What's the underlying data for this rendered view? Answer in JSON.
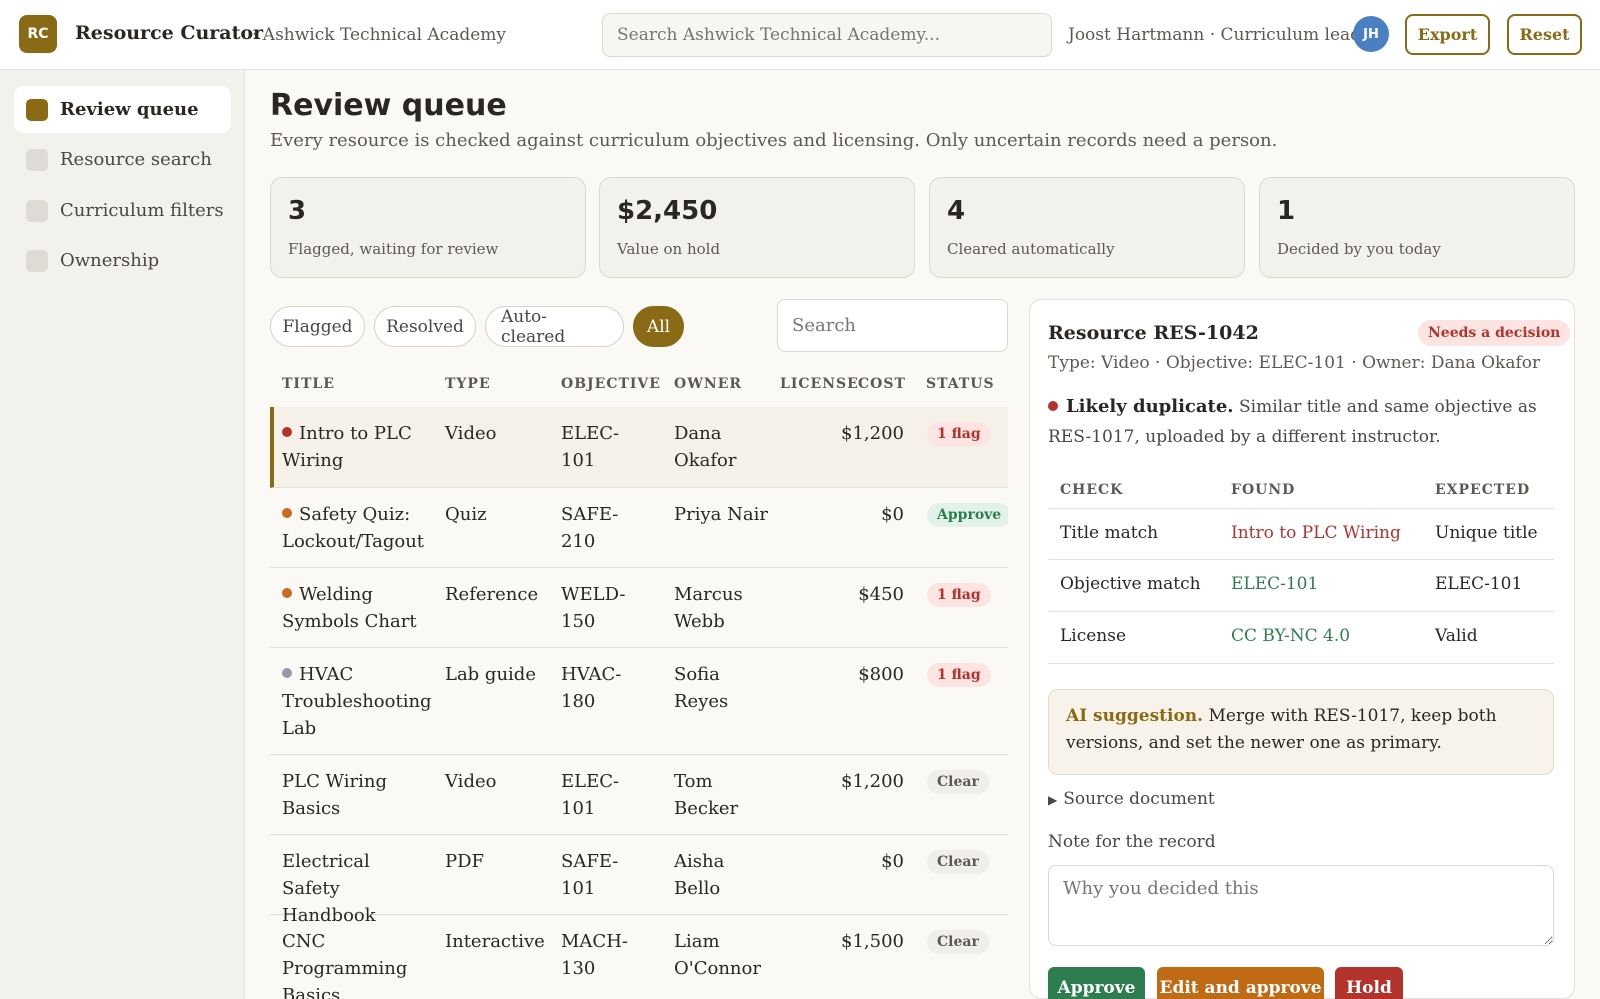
{
  "header": {
    "logo_text": "RC",
    "app_name": "Resource Curator",
    "org_name": "· Ashwick Technical Academy",
    "search_placeholder": "Search Ashwick Technical Academy...",
    "user_label": "Joost Hartmann · Curriculum lead",
    "avatar_initials": "JH",
    "export_label": "Export",
    "reset_label": "Reset"
  },
  "sidebar": {
    "items": [
      {
        "label": "Review queue",
        "active": true
      },
      {
        "label": "Resource search",
        "active": false
      },
      {
        "label": "Curriculum filters",
        "active": false
      },
      {
        "label": "Ownership",
        "active": false
      }
    ]
  },
  "main": {
    "title": "Review queue",
    "subtitle": "Every resource is checked against curriculum objectives and licensing. Only uncertain records need a person.",
    "stats": [
      {
        "value": "3",
        "label": "Flagged, waiting for review"
      },
      {
        "value": "$2,450",
        "label": "Value on hold"
      },
      {
        "value": "4",
        "label": "Cleared automatically"
      },
      {
        "value": "1",
        "label": "Decided by you today"
      }
    ],
    "filters": [
      {
        "label": "Flagged",
        "active": false
      },
      {
        "label": "Resolved",
        "active": false
      },
      {
        "label": "Auto-cleared",
        "active": false
      },
      {
        "label": "All",
        "active": true
      }
    ],
    "table_search_placeholder": "Search",
    "columns": [
      "TITLE",
      "TYPE",
      "OBJECTIVE",
      "OWNER",
      "LICENSE",
      "COST",
      "STATUS"
    ],
    "rows": [
      {
        "dot": "#b3322c",
        "title": "Intro to PLC Wiring",
        "type": "Video",
        "objective": "ELEC-101",
        "owner": "Dana Okafor",
        "license": "",
        "cost": "$1,200",
        "status": "1 flag",
        "status_kind": "flag",
        "selected": true
      },
      {
        "dot": "#c96a1c",
        "title": "Safety Quiz: Lockout/Tagout",
        "type": "Quiz",
        "objective": "SAFE-210",
        "owner": "Priya Nair",
        "license": "",
        "cost": "$0",
        "status": "Approve",
        "status_kind": "approve",
        "selected": false
      },
      {
        "dot": "#c96a1c",
        "title": "Welding Symbols Chart",
        "type": "Reference",
        "objective": "WELD-150",
        "owner": "Marcus Webb",
        "license": "",
        "cost": "$450",
        "status": "1 flag",
        "status_kind": "flag",
        "selected": false
      },
      {
        "dot": "#9a96a8",
        "title": "HVAC Troubleshooting Lab",
        "type": "Lab guide",
        "objective": "HVAC-180",
        "owner": "Sofia Reyes",
        "license": "",
        "cost": "$800",
        "status": "1 flag",
        "status_kind": "flag",
        "selected": false
      },
      {
        "dot": "",
        "title": "PLC Wiring Basics",
        "type": "Video",
        "objective": "ELEC-101",
        "owner": "Tom Becker",
        "license": "",
        "cost": "$1,200",
        "status": "Clear",
        "status_kind": "clear",
        "selected": false
      },
      {
        "dot": "",
        "title": "Electrical Safety Handbook",
        "type": "PDF",
        "objective": "SAFE-101",
        "owner": "Aisha Bello",
        "license": "",
        "cost": "$0",
        "status": "Clear",
        "status_kind": "clear",
        "selected": false
      },
      {
        "dot": "",
        "title": "CNC Programming Basics",
        "type": "Interactive",
        "objective": "MACH-130",
        "owner": "Liam O'Connor",
        "license": "",
        "cost": "$1,500",
        "status": "Clear",
        "status_kind": "clear",
        "selected": false
      }
    ]
  },
  "detail": {
    "title": "Resource RES-1042",
    "badge": "Needs a decision",
    "meta": "Type: Video · Objective: ELEC-101 · Owner: Dana Okafor",
    "issue_bold": "Likely duplicate.",
    "issue_text": "Similar title and same objective as RES-1017, uploaded by a different instructor.",
    "check_columns": [
      "CHECK",
      "FOUND",
      "EXPECTED"
    ],
    "checks": [
      {
        "check": "Title match",
        "found": "Intro to PLC Wiring",
        "found_color": "#b3322c",
        "expected": "Unique title"
      },
      {
        "check": "Objective match",
        "found": "ELEC-101",
        "found_color": "#2e7d4f",
        "expected": "ELEC-101"
      },
      {
        "check": "License",
        "found": "CC BY-NC 4.0",
        "found_color": "#2e7d4f",
        "expected": "Valid"
      }
    ],
    "ai_label": "AI suggestion.",
    "ai_text": "Merge with RES-1017, keep both versions, and set the newer one as primary.",
    "source_label": "Source document",
    "note_label": "Note for the record",
    "note_placeholder": "Why you decided this",
    "actions": {
      "approve": "Approve",
      "edit_approve": "Edit and approve",
      "hold": "Hold"
    }
  },
  "colors": {
    "accent": "#8a6a14",
    "danger": "#b3322c",
    "success": "#2e7d4f",
    "edit": "#c06a14"
  }
}
